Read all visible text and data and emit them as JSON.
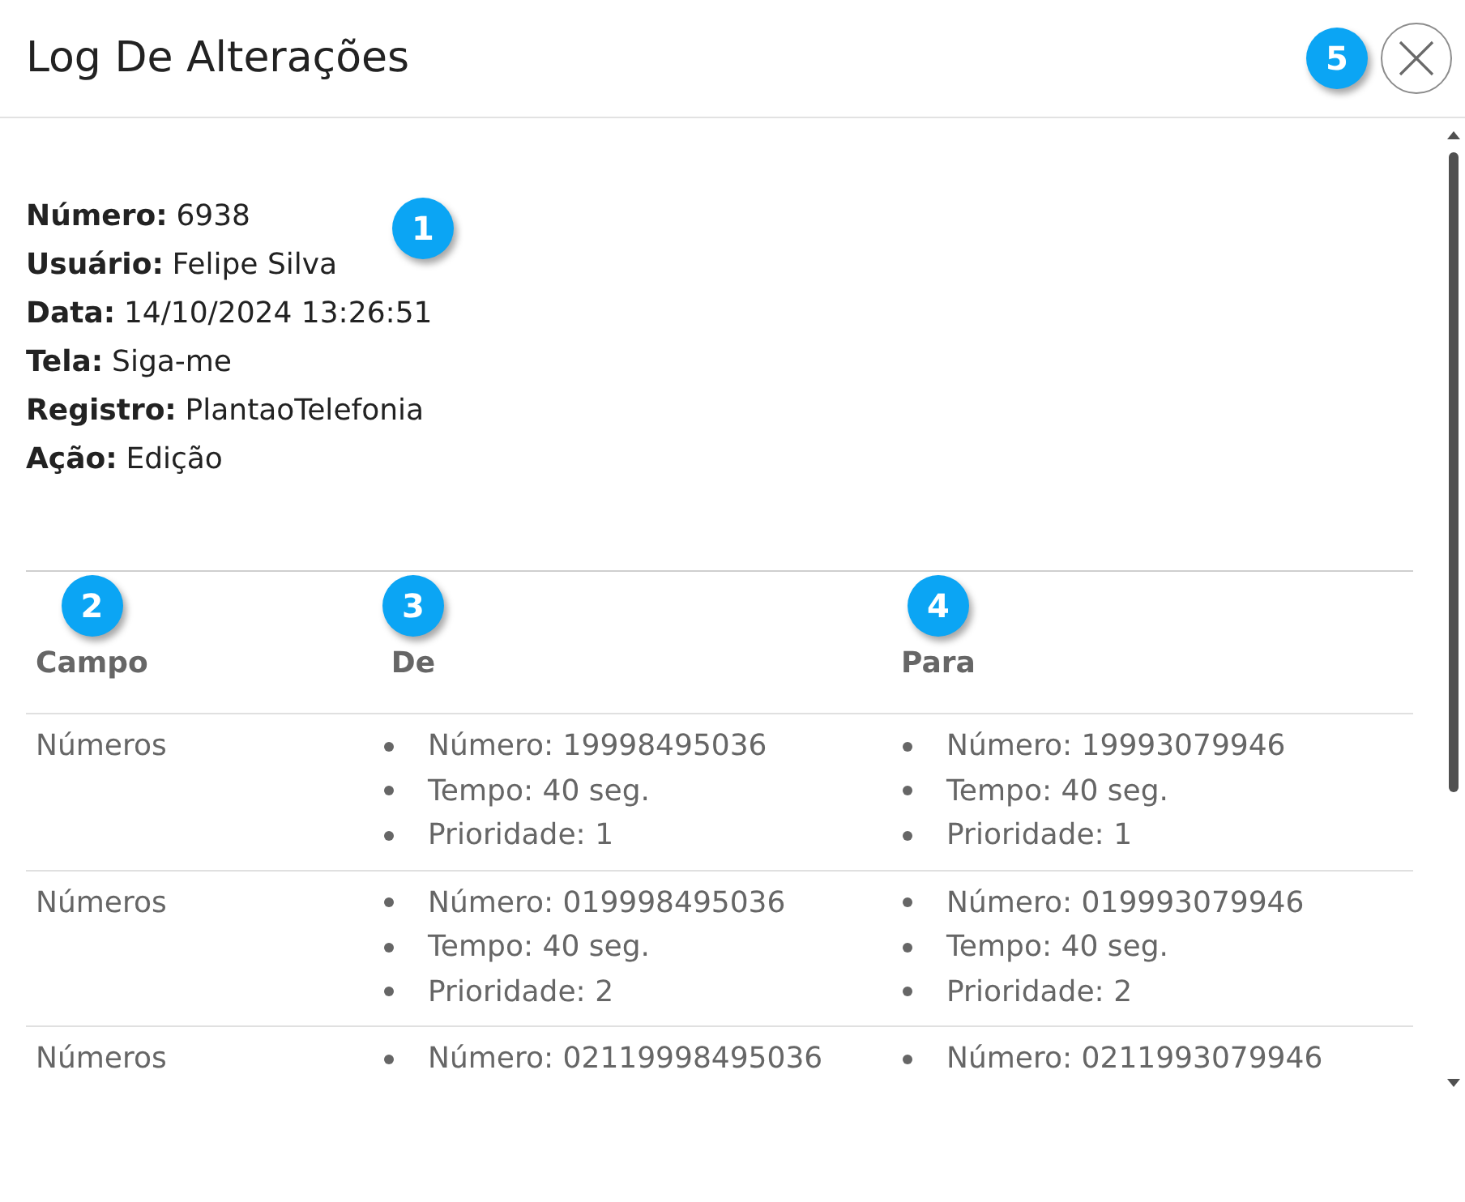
{
  "window": {
    "title": "Log De Alterações",
    "close_button": {
      "marker": "5"
    }
  },
  "details": {
    "marker": "1",
    "fields": [
      {
        "label": "Número:",
        "value": "6938"
      },
      {
        "label": "Usuário:",
        "value": "Felipe Silva"
      },
      {
        "label": "Data:",
        "value": "14/10/2024 13:26:51"
      },
      {
        "label": "Tela:",
        "value": "Siga-me"
      },
      {
        "label": "Registro:",
        "value": "PlantaoTelefonia"
      },
      {
        "label": "Ação:",
        "value": "Edição"
      }
    ]
  },
  "table": {
    "columns": [
      {
        "label": "Campo",
        "marker": "2"
      },
      {
        "label": "De",
        "marker": "3"
      },
      {
        "label": "Para",
        "marker": "4"
      }
    ],
    "rows": [
      {
        "field": "Números",
        "from": [
          "Número: 19998495036",
          "Tempo: 40 seg.",
          "Prioridade: 1"
        ],
        "to": [
          "Número: 19993079946",
          "Tempo: 40 seg.",
          "Prioridade: 1"
        ]
      },
      {
        "field": "Números",
        "from": [
          "Número: 019998495036",
          "Tempo: 40 seg.",
          "Prioridade: 2"
        ],
        "to": [
          "Número: 019993079946",
          "Tempo: 40 seg.",
          "Prioridade: 2"
        ]
      },
      {
        "field": "Números",
        "from": [
          "Número: 02119998495036"
        ],
        "to": [
          "Número: 0211993079946"
        ]
      }
    ]
  }
}
